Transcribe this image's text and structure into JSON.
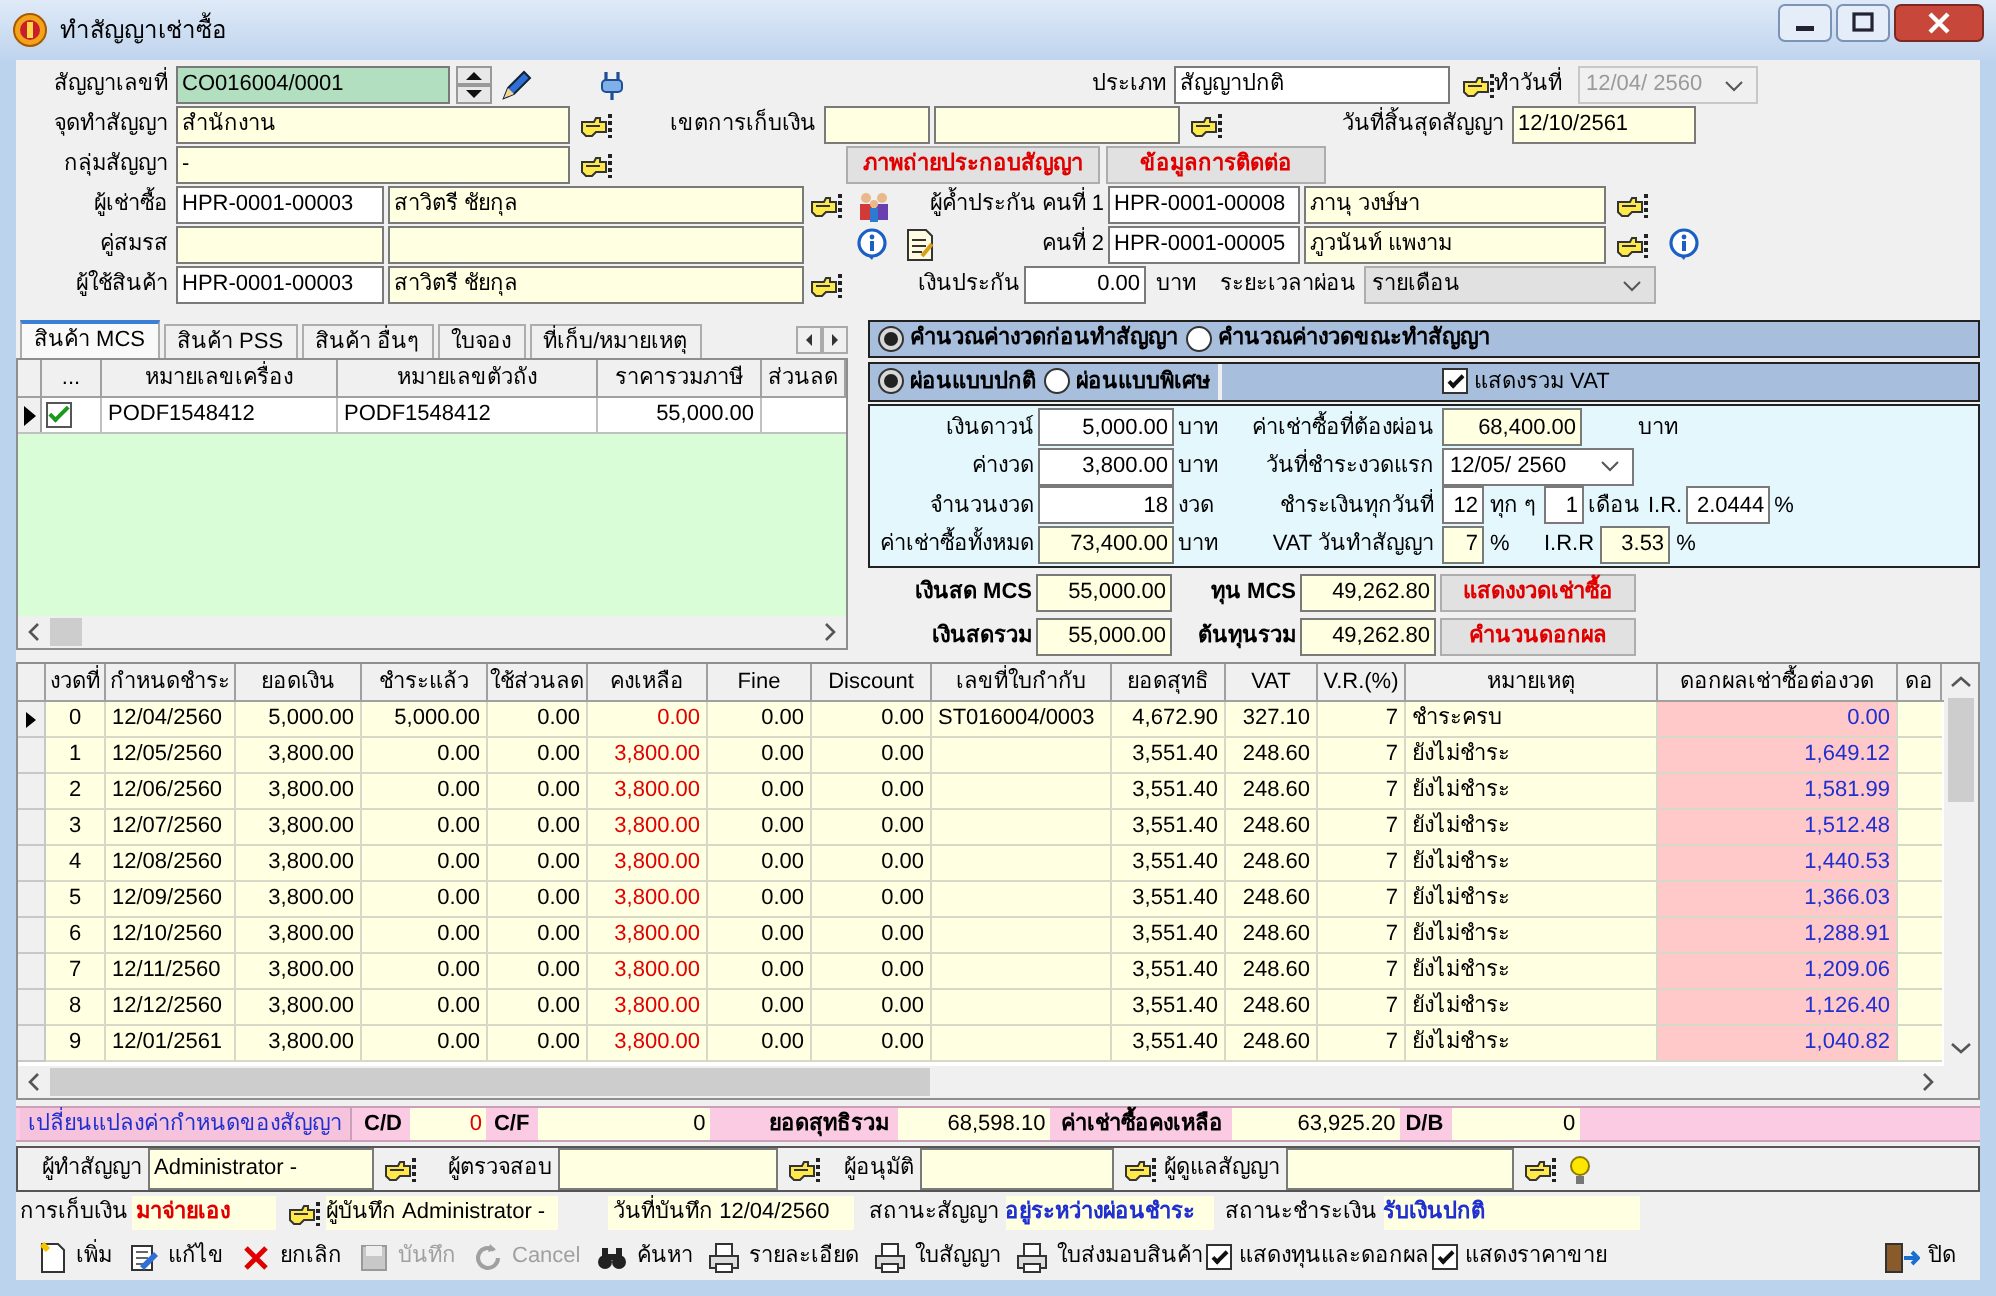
{
  "window": {
    "title": "ทำสัญญาเช่าซื้อ"
  },
  "header": {
    "contract_no": {
      "label": "สัญญาเลขที่",
      "value": "CO016004/0001"
    },
    "type": {
      "label": "ประเภท",
      "value": "สัญญาปกติ"
    },
    "made_date": {
      "label": "ทำวันที่",
      "value": "12/04/ 2560",
      "disabled": true
    },
    "location": {
      "label": "จุดทำสัญญา",
      "value": "สำนักงาน"
    },
    "collection_zone": {
      "label": "เขตการเก็บเงิน"
    },
    "end_date": {
      "label": "วันที่สิ้นสุดสัญญา",
      "value": "12/10/2561"
    },
    "group": {
      "label": "กลุ่มสัญญา",
      "value": "-"
    },
    "buttons": [
      "ภาพถ่ายประกอบสัญญา",
      "ข้อมูลการติดต่อ"
    ],
    "hirer": {
      "label": "ผู้เช่าซื้อ",
      "code": "HPR-0001-00003",
      "name": "สาวิตรี ชัยกุล"
    },
    "spouse": {
      "label": "คู่สมรส"
    },
    "product_user": {
      "label": "ผู้ใช้สินค้า",
      "code": "HPR-0001-00003",
      "name": "สาวิตรี ชัยกุล"
    },
    "guarantor_1": {
      "label": "ผู้ค้ำประกัน คนที่ 1",
      "code": "HPR-0001-00008",
      "name": "ภานุ วงษ์ษา"
    },
    "guarantor_2": {
      "label": "คนที่ 2",
      "code": "HPR-0001-00005",
      "name": "ภูวนันท์ แพงาม"
    },
    "deposit": {
      "label": "เงินประกัน",
      "value": "0.00",
      "unit": "บาท"
    },
    "period": {
      "label": "ระยะเวลาผ่อน",
      "value": "รายเดือน"
    }
  },
  "tabs": [
    {
      "label": "สินค้า MCS",
      "selected": true
    },
    {
      "label": "สินค้า PSS",
      "selected": false
    },
    {
      "label": "สินค้า อื่นๆ",
      "selected": false
    },
    {
      "label": "ใบจอง",
      "selected": false
    },
    {
      "label": "ที่เก็บ/หมายเหตุ",
      "selected": false
    }
  ],
  "products": {
    "columns": [
      "...",
      "หมายเลขเครื่อง",
      "หมายเลขตัวถัง",
      "ราคารวมภาษี",
      "ส่วนลด"
    ],
    "rows": [
      {
        "selected": true,
        "checked": true,
        "engine_no": "PODF1548412",
        "chassis_no": "PODF1548412",
        "price": "55,000.00"
      }
    ]
  },
  "calc_mode": [
    {
      "label": "คำนวณค่างวดก่อนทำสัญญา",
      "selected": true
    },
    {
      "label": "คำนวณค่างวดขณะทำสัญญา",
      "selected": false
    }
  ],
  "pay_mode": [
    {
      "label": "ผ่อนแบบปกติ",
      "selected": true
    },
    {
      "label": "ผ่อนแบบพิเศษ",
      "selected": false
    }
  ],
  "show_vat": {
    "label": "แสดงรวม VAT",
    "checked": true
  },
  "calc": {
    "down_payment": {
      "label": "เงินดาวน์",
      "value": "5,000.00",
      "unit": "บาท"
    },
    "installment": {
      "label": "ค่างวด",
      "value": "3,800.00",
      "unit": "บาท"
    },
    "count": {
      "label": "จำนวนงวด",
      "value": "18",
      "unit": "งวด"
    },
    "total": {
      "label": "ค่าเช่าซื้อทั้งหมด",
      "value": "73,400.00",
      "unit": "บาท"
    },
    "to_pay": {
      "label": "ค่าเช่าซื้อที่ต้องผ่อน",
      "value": "68,400.00",
      "unit": "บาท"
    },
    "first_date": {
      "label": "วันที่ชำระงวดแรก",
      "value": "12/05/ 2560"
    },
    "pay_day": {
      "label": "ชำระเงินทุกวันที่",
      "value": "12",
      "every_label": "ทุก ๆ",
      "every_value": "1",
      "every_unit": "เดือน",
      "ir_label": "I.R.",
      "ir_value": "2.0444",
      "ir_unit": "%"
    },
    "vat": {
      "label": "VAT วันทำสัญญา",
      "value": "7",
      "unit": "%",
      "irr_label": "I.R.R",
      "irr_value": "3.53",
      "irr_unit": "%"
    }
  },
  "totals": {
    "cash_mcs": {
      "label": "เงินสด MCS",
      "value": "55,000.00"
    },
    "cost_mcs": {
      "label": "ทุน MCS",
      "value": "49,262.80"
    },
    "cash_total": {
      "label": "เงินสดรวม",
      "value": "55,000.00"
    },
    "cost_total": {
      "label": "ต้นทุนรวม",
      "value": "49,262.80"
    },
    "buttons": [
      "แสดงงวดเช่าซื้อ",
      "คำนวนดอกผล"
    ]
  },
  "schedule": {
    "columns": [
      "งวดที่",
      "กำหนดชำระ",
      "ยอดเงิน",
      "ชำระแล้ว",
      "ใช้ส่วนลด",
      "คงเหลือ",
      "Fine",
      "Discount",
      "เลขที่ใบกำกับ",
      "ยอดสุทธิ",
      "VAT",
      "V.R.(%)",
      "หมายเหตุ",
      "ดอกผลเช่าซื้อต่องวด",
      "ดอ"
    ],
    "rows": [
      {
        "selected": true,
        "no": "0",
        "due": "12/04/2560",
        "amount": "5,000.00",
        "paid": "5,000.00",
        "discount_used": "0.00",
        "balance": "0.00",
        "fine": "0.00",
        "discount": "0.00",
        "invoice": "ST016004/0003",
        "net": "4,672.90",
        "vat": "327.10",
        "vr": "7",
        "note": "ชำระครบ",
        "interest": "0.00"
      },
      {
        "selected": false,
        "no": "1",
        "due": "12/05/2560",
        "amount": "3,800.00",
        "paid": "0.00",
        "discount_used": "0.00",
        "balance": "3,800.00",
        "fine": "0.00",
        "discount": "0.00",
        "net": "3,551.40",
        "vat": "248.60",
        "vr": "7",
        "note": "ยังไม่ชำระ",
        "interest": "1,649.12"
      },
      {
        "selected": false,
        "no": "2",
        "due": "12/06/2560",
        "amount": "3,800.00",
        "paid": "0.00",
        "discount_used": "0.00",
        "balance": "3,800.00",
        "fine": "0.00",
        "discount": "0.00",
        "net": "3,551.40",
        "vat": "248.60",
        "vr": "7",
        "note": "ยังไม่ชำระ",
        "interest": "1,581.99"
      },
      {
        "selected": false,
        "no": "3",
        "due": "12/07/2560",
        "amount": "3,800.00",
        "paid": "0.00",
        "discount_used": "0.00",
        "balance": "3,800.00",
        "fine": "0.00",
        "discount": "0.00",
        "net": "3,551.40",
        "vat": "248.60",
        "vr": "7",
        "note": "ยังไม่ชำระ",
        "interest": "1,512.48"
      },
      {
        "selected": false,
        "no": "4",
        "due": "12/08/2560",
        "amount": "3,800.00",
        "paid": "0.00",
        "discount_used": "0.00",
        "balance": "3,800.00",
        "fine": "0.00",
        "discount": "0.00",
        "net": "3,551.40",
        "vat": "248.60",
        "vr": "7",
        "note": "ยังไม่ชำระ",
        "interest": "1,440.53"
      },
      {
        "selected": false,
        "no": "5",
        "due": "12/09/2560",
        "amount": "3,800.00",
        "paid": "0.00",
        "discount_used": "0.00",
        "balance": "3,800.00",
        "fine": "0.00",
        "discount": "0.00",
        "net": "3,551.40",
        "vat": "248.60",
        "vr": "7",
        "note": "ยังไม่ชำระ",
        "interest": "1,366.03"
      },
      {
        "selected": false,
        "no": "6",
        "due": "12/10/2560",
        "amount": "3,800.00",
        "paid": "0.00",
        "discount_used": "0.00",
        "balance": "3,800.00",
        "fine": "0.00",
        "discount": "0.00",
        "net": "3,551.40",
        "vat": "248.60",
        "vr": "7",
        "note": "ยังไม่ชำระ",
        "interest": "1,288.91"
      },
      {
        "selected": false,
        "no": "7",
        "due": "12/11/2560",
        "amount": "3,800.00",
        "paid": "0.00",
        "discount_used": "0.00",
        "balance": "3,800.00",
        "fine": "0.00",
        "discount": "0.00",
        "net": "3,551.40",
        "vat": "248.60",
        "vr": "7",
        "note": "ยังไม่ชำระ",
        "interest": "1,209.06"
      },
      {
        "selected": false,
        "no": "8",
        "due": "12/12/2560",
        "amount": "3,800.00",
        "paid": "0.00",
        "discount_used": "0.00",
        "balance": "3,800.00",
        "fine": "0.00",
        "discount": "0.00",
        "net": "3,551.40",
        "vat": "248.60",
        "vr": "7",
        "note": "ยังไม่ชำระ",
        "interest": "1,126.40"
      },
      {
        "selected": false,
        "no": "9",
        "due": "12/01/2561",
        "amount": "3,800.00",
        "paid": "0.00",
        "discount_used": "0.00",
        "balance": "3,800.00",
        "fine": "0.00",
        "discount": "0.00",
        "net": "3,551.40",
        "vat": "248.60",
        "vr": "7",
        "note": "ยังไม่ชำระ",
        "interest": "1,040.82"
      }
    ]
  },
  "summary": {
    "change_button": "เปลี่ยนแปลงค่ากำหนดของสัญญา",
    "cd": {
      "label": "C/D",
      "value": "0"
    },
    "cf": {
      "label": "C/F",
      "value": "0"
    },
    "net_total": {
      "label": "ยอดสุทธิรวม",
      "value": "68,598.10"
    },
    "remaining": {
      "label": "ค่าเช่าซื้อคงเหลือ",
      "value": "63,925.20"
    },
    "db": {
      "label": "D/B",
      "value": "0"
    }
  },
  "staff": [
    {
      "label": "ผู้ทำสัญญา",
      "value": "Administrator -"
    },
    {
      "label": "ผู้ตรวจสอบ"
    },
    {
      "label": "ผู้อนุมัติ"
    },
    {
      "label": "ผู้ดูแลสัญญา"
    }
  ],
  "status": {
    "collection": {
      "label": "การเก็บเงิน",
      "value": "มาจ่ายเอง"
    },
    "recorder": "ผู้บันทึก Administrator -",
    "record_date": "วันที่บันทึก 12/04/2560",
    "contract_status": {
      "label": "สถานะสัญญา",
      "value": "อยู่ระหว่างผ่อนชำระ"
    },
    "payment_status": {
      "label": "สถานะชำระเงิน",
      "value": "รับเงินปกติ"
    }
  },
  "toolbar": [
    {
      "kind": "button",
      "label": "เพิ่ม",
      "disabled": false
    },
    {
      "kind": "button",
      "label": "แก้ไข",
      "disabled": false
    },
    {
      "kind": "button",
      "label": "ยกเลิก",
      "disabled": false
    },
    {
      "kind": "button",
      "label": "บันทึก",
      "disabled": true
    },
    {
      "kind": "button",
      "label": "Cancel",
      "disabled": true
    },
    {
      "kind": "button",
      "label": "ค้นหา",
      "disabled": false
    },
    {
      "kind": "button",
      "label": "รายละเอียด",
      "disabled": false
    },
    {
      "kind": "button",
      "label": "ใบสัญญา",
      "disabled": false
    },
    {
      "kind": "button",
      "label": "ใบส่งมอบสินค้า",
      "disabled": false
    },
    {
      "kind": "checkbox",
      "label": "แสดงทุนและดอกผล",
      "checked": true
    },
    {
      "kind": "checkbox",
      "label": "แสดงราคาขาย",
      "checked": true
    }
  ],
  "close_button": "ปิด"
}
